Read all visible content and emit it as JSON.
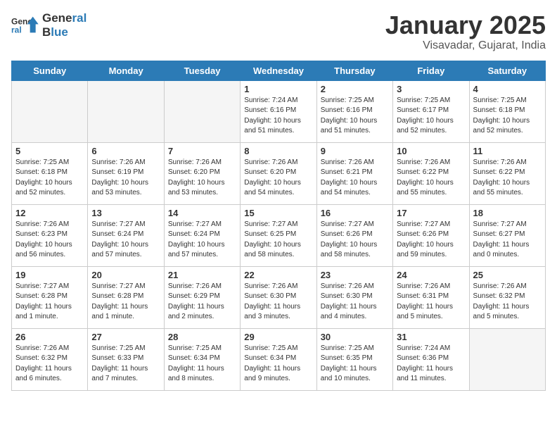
{
  "header": {
    "logo_line1": "General",
    "logo_line2": "Blue",
    "title": "January 2025",
    "subtitle": "Visavadar, Gujarat, India"
  },
  "days_of_week": [
    "Sunday",
    "Monday",
    "Tuesday",
    "Wednesday",
    "Thursday",
    "Friday",
    "Saturday"
  ],
  "weeks": [
    [
      {
        "day": "",
        "info": ""
      },
      {
        "day": "",
        "info": ""
      },
      {
        "day": "",
        "info": ""
      },
      {
        "day": "1",
        "info": "Sunrise: 7:24 AM\nSunset: 6:16 PM\nDaylight: 10 hours\nand 51 minutes."
      },
      {
        "day": "2",
        "info": "Sunrise: 7:25 AM\nSunset: 6:16 PM\nDaylight: 10 hours\nand 51 minutes."
      },
      {
        "day": "3",
        "info": "Sunrise: 7:25 AM\nSunset: 6:17 PM\nDaylight: 10 hours\nand 52 minutes."
      },
      {
        "day": "4",
        "info": "Sunrise: 7:25 AM\nSunset: 6:18 PM\nDaylight: 10 hours\nand 52 minutes."
      }
    ],
    [
      {
        "day": "5",
        "info": "Sunrise: 7:25 AM\nSunset: 6:18 PM\nDaylight: 10 hours\nand 52 minutes."
      },
      {
        "day": "6",
        "info": "Sunrise: 7:26 AM\nSunset: 6:19 PM\nDaylight: 10 hours\nand 53 minutes."
      },
      {
        "day": "7",
        "info": "Sunrise: 7:26 AM\nSunset: 6:20 PM\nDaylight: 10 hours\nand 53 minutes."
      },
      {
        "day": "8",
        "info": "Sunrise: 7:26 AM\nSunset: 6:20 PM\nDaylight: 10 hours\nand 54 minutes."
      },
      {
        "day": "9",
        "info": "Sunrise: 7:26 AM\nSunset: 6:21 PM\nDaylight: 10 hours\nand 54 minutes."
      },
      {
        "day": "10",
        "info": "Sunrise: 7:26 AM\nSunset: 6:22 PM\nDaylight: 10 hours\nand 55 minutes."
      },
      {
        "day": "11",
        "info": "Sunrise: 7:26 AM\nSunset: 6:22 PM\nDaylight: 10 hours\nand 55 minutes."
      }
    ],
    [
      {
        "day": "12",
        "info": "Sunrise: 7:26 AM\nSunset: 6:23 PM\nDaylight: 10 hours\nand 56 minutes."
      },
      {
        "day": "13",
        "info": "Sunrise: 7:27 AM\nSunset: 6:24 PM\nDaylight: 10 hours\nand 57 minutes."
      },
      {
        "day": "14",
        "info": "Sunrise: 7:27 AM\nSunset: 6:24 PM\nDaylight: 10 hours\nand 57 minutes."
      },
      {
        "day": "15",
        "info": "Sunrise: 7:27 AM\nSunset: 6:25 PM\nDaylight: 10 hours\nand 58 minutes."
      },
      {
        "day": "16",
        "info": "Sunrise: 7:27 AM\nSunset: 6:26 PM\nDaylight: 10 hours\nand 58 minutes."
      },
      {
        "day": "17",
        "info": "Sunrise: 7:27 AM\nSunset: 6:26 PM\nDaylight: 10 hours\nand 59 minutes."
      },
      {
        "day": "18",
        "info": "Sunrise: 7:27 AM\nSunset: 6:27 PM\nDaylight: 11 hours\nand 0 minutes."
      }
    ],
    [
      {
        "day": "19",
        "info": "Sunrise: 7:27 AM\nSunset: 6:28 PM\nDaylight: 11 hours\nand 1 minute."
      },
      {
        "day": "20",
        "info": "Sunrise: 7:27 AM\nSunset: 6:28 PM\nDaylight: 11 hours\nand 1 minute."
      },
      {
        "day": "21",
        "info": "Sunrise: 7:26 AM\nSunset: 6:29 PM\nDaylight: 11 hours\nand 2 minutes."
      },
      {
        "day": "22",
        "info": "Sunrise: 7:26 AM\nSunset: 6:30 PM\nDaylight: 11 hours\nand 3 minutes."
      },
      {
        "day": "23",
        "info": "Sunrise: 7:26 AM\nSunset: 6:30 PM\nDaylight: 11 hours\nand 4 minutes."
      },
      {
        "day": "24",
        "info": "Sunrise: 7:26 AM\nSunset: 6:31 PM\nDaylight: 11 hours\nand 5 minutes."
      },
      {
        "day": "25",
        "info": "Sunrise: 7:26 AM\nSunset: 6:32 PM\nDaylight: 11 hours\nand 5 minutes."
      }
    ],
    [
      {
        "day": "26",
        "info": "Sunrise: 7:26 AM\nSunset: 6:32 PM\nDaylight: 11 hours\nand 6 minutes."
      },
      {
        "day": "27",
        "info": "Sunrise: 7:25 AM\nSunset: 6:33 PM\nDaylight: 11 hours\nand 7 minutes."
      },
      {
        "day": "28",
        "info": "Sunrise: 7:25 AM\nSunset: 6:34 PM\nDaylight: 11 hours\nand 8 minutes."
      },
      {
        "day": "29",
        "info": "Sunrise: 7:25 AM\nSunset: 6:34 PM\nDaylight: 11 hours\nand 9 minutes."
      },
      {
        "day": "30",
        "info": "Sunrise: 7:25 AM\nSunset: 6:35 PM\nDaylight: 11 hours\nand 10 minutes."
      },
      {
        "day": "31",
        "info": "Sunrise: 7:24 AM\nSunset: 6:36 PM\nDaylight: 11 hours\nand 11 minutes."
      },
      {
        "day": "",
        "info": ""
      }
    ]
  ]
}
